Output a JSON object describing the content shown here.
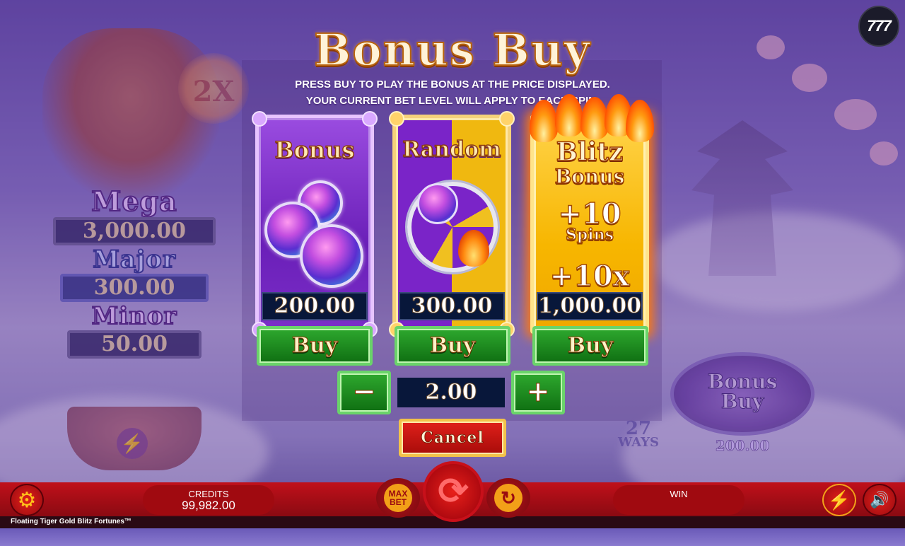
{
  "dialog": {
    "title": "Bonus Buy",
    "subtitle_line1": "PRESS BUY TO PLAY THE BONUS AT THE PRICE DISPLAYED.",
    "subtitle_line2": "YOUR CURRENT BET LEVEL WILL APPLY TO EACH SPIN.",
    "cards": [
      {
        "label": "Bonus",
        "price": "200.00",
        "buy_label": "Buy"
      },
      {
        "label": "Random",
        "price": "300.00",
        "buy_label": "Buy"
      },
      {
        "label": "Blitz",
        "label_sub": "Bonus",
        "extra_spins": "+10",
        "extra_spins_label": "Spins",
        "extra_multiplier": "+10x",
        "price": "1,000.00",
        "buy_label": "Buy"
      }
    ],
    "bet": {
      "minus": "−",
      "value": "2.00",
      "plus": "+"
    },
    "cancel_label": "Cancel"
  },
  "background": {
    "multiplier": "2X",
    "jackpots": [
      {
        "name": "Mega",
        "value": "3,000.00"
      },
      {
        "name": "Major",
        "value": "300.00"
      },
      {
        "name": "Minor",
        "value": "50.00"
      }
    ],
    "side_bonus_label_1": "Bonus",
    "side_bonus_label_2": "Buy",
    "side_bonus_price": "200.00",
    "ways_number": "27",
    "ways_label": "WAYS"
  },
  "logo": "777",
  "bottom_bar": {
    "credits_label": "CREDITS",
    "credits_value": "99,982.00",
    "win_label": "WIN",
    "max_bet_line1": "MAX",
    "max_bet_line2": "BET",
    "game_name": "Floating Tiger Gold Blitz Fortunes™"
  },
  "icons": {
    "settings": "gear-icon",
    "spin": "spin-arrow-icon",
    "autoplay": "autoplay-icon",
    "turbo": "lightning-icon",
    "sound": "speaker-icon"
  },
  "colors": {
    "buy_green": "#1f8f1f",
    "cancel_red": "#c8141a",
    "bar_red": "#b00e16",
    "gold": "#f2a018"
  }
}
